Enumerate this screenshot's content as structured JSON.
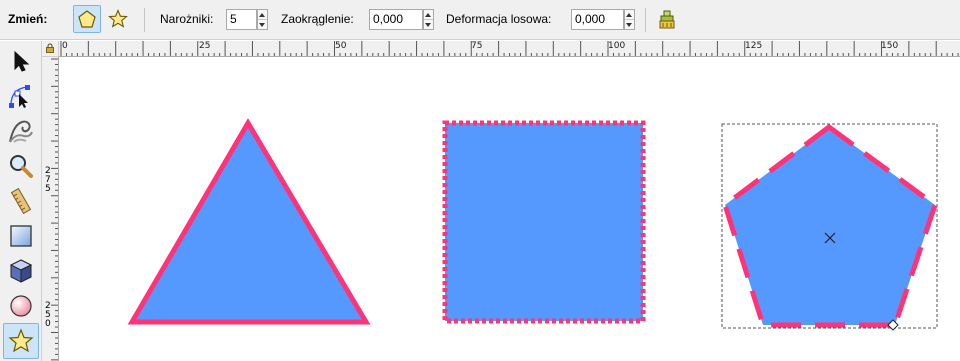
{
  "toolbar": {
    "change_label": "Zmień:",
    "polygon_mode": "polygon-icon",
    "star_mode": "star-icon",
    "corners_label": "Narożniki:",
    "corners_value": "5",
    "rounding_label": "Zaokrąglenie:",
    "rounding_value": "0,000",
    "randomization_label": "Deformacja losowa:",
    "randomization_value": "0,000",
    "reset_icon": "reset-defaults-icon"
  },
  "tools": [
    {
      "name": "selector-tool",
      "icon": "arrow-icon",
      "active": false
    },
    {
      "name": "node-tool",
      "icon": "node-icon",
      "active": false
    },
    {
      "name": "tweak-tool",
      "icon": "tweak-icon",
      "active": false
    },
    {
      "name": "zoom-tool",
      "icon": "magnifier-icon",
      "active": false
    },
    {
      "name": "measure-tool",
      "icon": "ruler-icon",
      "active": false
    },
    {
      "name": "rectangle-tool",
      "icon": "rectangle-icon",
      "active": false
    },
    {
      "name": "box3d-tool",
      "icon": "box3d-icon",
      "active": false
    },
    {
      "name": "ellipse-tool",
      "icon": "ellipse-icon",
      "active": false
    },
    {
      "name": "star-polygon-tool",
      "icon": "star-icon",
      "active": true
    }
  ],
  "ruler": {
    "h_labels": [
      "0",
      "25",
      "50",
      "75",
      "100",
      "125",
      "150"
    ],
    "v_labels": [
      "2 7 5",
      "2 5 0"
    ]
  },
  "shapes": {
    "fill": "#5599ff",
    "stroke": "#ff3377",
    "triangle": "triangle",
    "square": "square",
    "pentagon": "pentagon"
  },
  "colors": {
    "ui_bg": "#f0f0f0",
    "active_bg": "#cce4f7",
    "active_border": "#7eb4ea"
  }
}
